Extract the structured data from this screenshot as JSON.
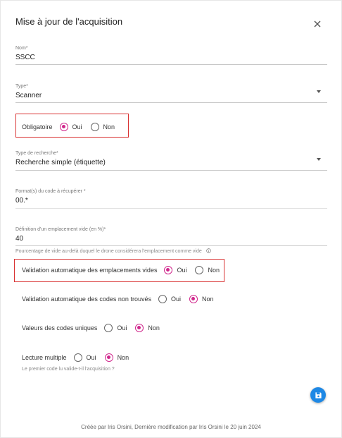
{
  "dialog": {
    "title": "Mise à jour de l'acquisition",
    "close_icon": "close-icon"
  },
  "fields": {
    "nom": {
      "label": "Nom*",
      "value": "SSCC"
    },
    "type": {
      "label": "Type*",
      "value": "Scanner"
    },
    "obligatoire": {
      "label": "Obligatoire",
      "oui": "Oui",
      "non": "Non",
      "selected": "Oui"
    },
    "type_recherche": {
      "label": "Type de recherche*",
      "value": "Recherche simple (étiquette)"
    },
    "format": {
      "label": "Format(s) du code à récupérer *",
      "value": "00.*"
    },
    "definition": {
      "label": "Définition d'un emplacement vide (en %)*",
      "value": "40",
      "hint": "Pourcentage de vide au-delà duquel le drone considérera l'emplacement comme vide"
    }
  },
  "options": {
    "validation_vides": {
      "label": "Validation automatique des emplacements vides",
      "oui": "Oui",
      "non": "Non",
      "selected": "Oui"
    },
    "validation_non_trouves": {
      "label": "Validation automatique des codes non trouvés",
      "oui": "Oui",
      "non": "Non",
      "selected": "Non"
    },
    "valeurs_uniques": {
      "label": "Valeurs des codes uniques",
      "oui": "Oui",
      "non": "Non",
      "selected": "Non"
    },
    "lecture_multiple": {
      "label": "Lecture multiple",
      "oui": "Oui",
      "non": "Non",
      "selected": "Non",
      "hint": "Le premier code lu valide-t-il l'acquisition ?"
    }
  },
  "actions": {
    "save_icon": "save-icon"
  },
  "footer": {
    "text": "Créée par Iris Orsini, Dernière modification par Iris Orsini le 20 juin 2024"
  },
  "colors": {
    "accent": "#d0278c",
    "highlight": "#d93333",
    "fab": "#1e88e5"
  }
}
